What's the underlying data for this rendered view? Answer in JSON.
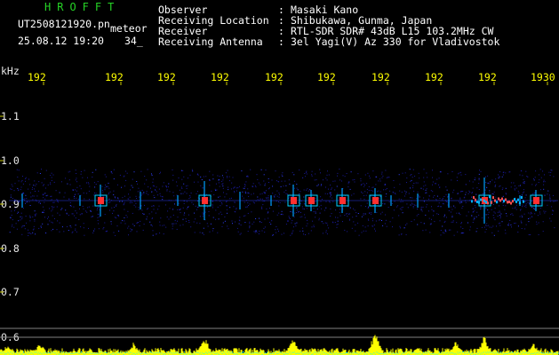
{
  "header": {
    "software": "HROFFT",
    "filename": "UT2508121920.pn",
    "meteor_label": "meteor",
    "datetime": "25.08.12 19:20",
    "count": "34_",
    "fields": [
      {
        "label": "Observer",
        "value": "Masaki Kano"
      },
      {
        "label": "Receiving Location",
        "value": "Shibukawa, Gunma, Japan"
      },
      {
        "label": "Receiver",
        "value": "RTL-SDR SDR# 43dB L15 103.2MHz CW"
      },
      {
        "label": "Receiving Antenna",
        "value": "3el Yagi(V) Az 330 for Vladivostok"
      }
    ]
  },
  "time_ticks": [
    "192",
    "192",
    "192",
    "192",
    "192",
    "192",
    "192",
    "192",
    "192",
    "1930"
  ],
  "freq_axis": {
    "unit": "kHz",
    "ticks": [
      "1.1",
      "1.0",
      "0.9",
      "0.8",
      "0.7",
      "0.6"
    ]
  },
  "colors": {
    "header_green": "#26d326",
    "label_text": "#ffffff",
    "time_ticks": "#ffff00",
    "axis_labels": "#ffff00",
    "spectrum": "#ffff00",
    "baseline": "#00ffff",
    "signal_hot": "#ff3030",
    "signal_mid": "#00a0ff",
    "background": "#000000"
  }
}
